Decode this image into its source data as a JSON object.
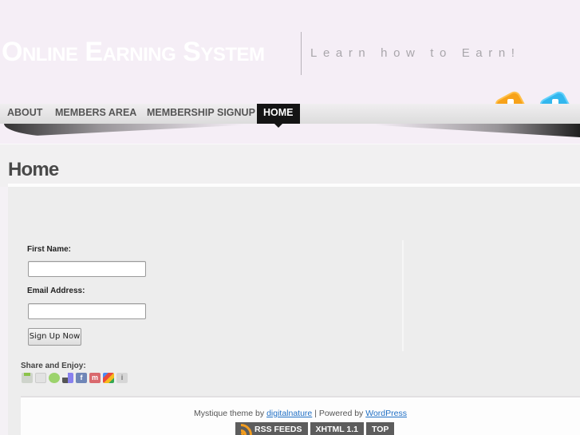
{
  "header": {
    "site_title": "Online Earning System",
    "tagline": "Learn how to Earn!",
    "social_icons": [
      "rss-feed-icon",
      "twitter-icon"
    ]
  },
  "nav": {
    "items": [
      {
        "label": "ABOUT",
        "active": false
      },
      {
        "label": "MEMBERS AREA",
        "active": false
      },
      {
        "label": "MEMBERSHIP SIGNUP",
        "active": false
      },
      {
        "label": "HOME",
        "active": true
      }
    ]
  },
  "page": {
    "title": "Home"
  },
  "form": {
    "first_name_label": "First Name:",
    "first_name_value": "",
    "email_label": "Email Address:",
    "email_value": "",
    "submit_label": "Sign Up Now"
  },
  "share": {
    "label": "Share and Enjoy:",
    "icons": [
      "print-icon",
      "digg-icon",
      "sphinn-icon",
      "delicious-icon",
      "facebook-icon",
      "mixx-icon",
      "google-bookmarks-icon",
      "info-icon"
    ],
    "facebook_glyph": "f",
    "mixx_glyph": "m",
    "info_glyph": "i"
  },
  "footer": {
    "credit_prefix": "Mystique theme by ",
    "credit_link": "digitalnature",
    "credit_mid": " | Powered by ",
    "wordpress_link": "WordPress",
    "buttons": [
      "RSS FEEDS",
      "XHTML 1.1",
      "TOP"
    ]
  },
  "colors": {
    "background": "#f5eef6",
    "nav_active": "#141414",
    "link": "#1f6fc5",
    "footer_button": "#5d5d5d",
    "rss_orange": "#f39d1f"
  }
}
